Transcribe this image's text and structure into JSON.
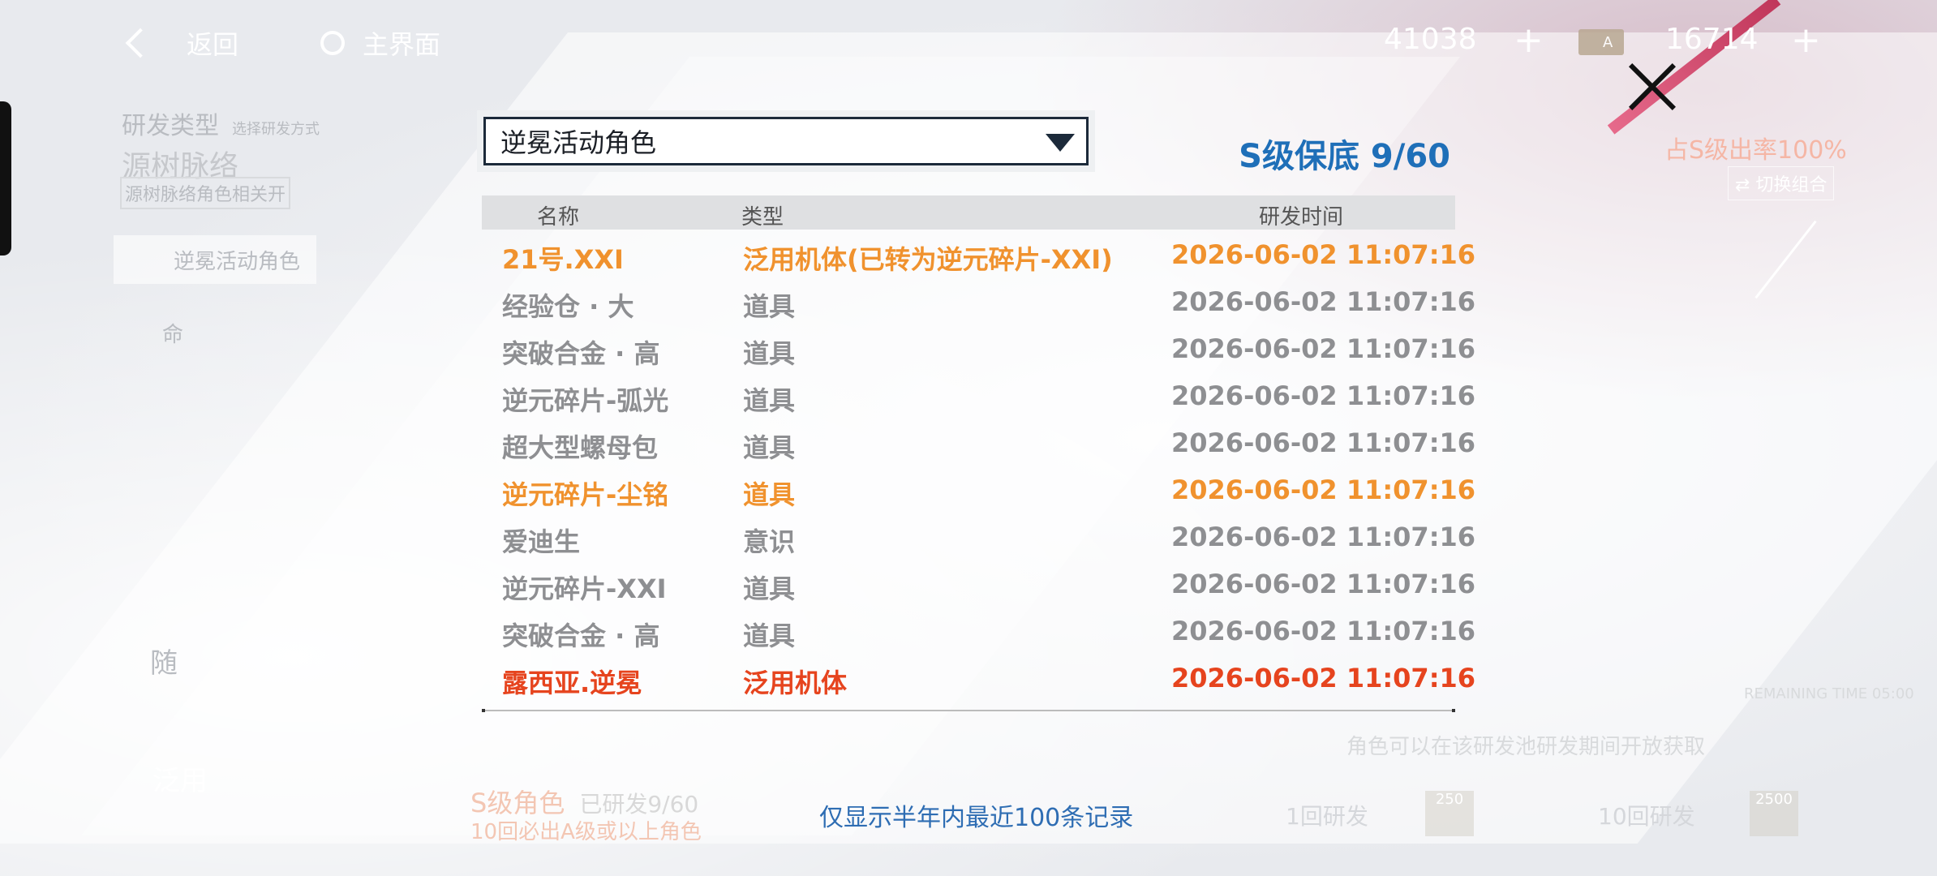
{
  "topbar": {
    "back_label": "返回",
    "home_label": "主界面",
    "currency1": "41038",
    "currency2": "16714",
    "plus": "+",
    "ticket_label": "A"
  },
  "background": {
    "type_label": "研发类型",
    "type_hint": "选择研发方式",
    "pool_title": "源树脉络",
    "pool_sub": "源树脉络角色相关开",
    "selected_pool": "逆冕活动角色",
    "other_pool": "命",
    "random_label": "随",
    "general_label": "泛用",
    "s_rank": "S级角色",
    "s_progress": "已研发9/60",
    "ten_pull_note": "10回必出A级或以上角色",
    "rate_label": "占S级出率100%",
    "switch_label": "切换组合",
    "single_label": "1回研发",
    "ten_label": "10回研发",
    "single_cost": "250",
    "ten_cost": "2500",
    "right_note": "角色可以在该研发池研发期间开放获取",
    "time_label": "REMAINING TIME 05:00"
  },
  "dialog": {
    "dropdown_value": "逆冕活动角色",
    "pity_label": "S级保底 9/60",
    "columns": {
      "name": "名称",
      "type": "类型",
      "time": "研发时间"
    },
    "rows": [
      {
        "name": "21号.XXI",
        "type": "泛用机体(已转为逆元碎片-XXI)",
        "time": "2026-06-02 11:07:16",
        "rarity": "gold"
      },
      {
        "name": "经验仓 · 大",
        "type": "道具",
        "time": "2026-06-02 11:07:16",
        "rarity": "normal"
      },
      {
        "name": "突破合金 · 高",
        "type": "道具",
        "time": "2026-06-02 11:07:16",
        "rarity": "normal"
      },
      {
        "name": "逆元碎片-弧光",
        "type": "道具",
        "time": "2026-06-02 11:07:16",
        "rarity": "normal"
      },
      {
        "name": "超大型螺母包",
        "type": "道具",
        "time": "2026-06-02 11:07:16",
        "rarity": "normal"
      },
      {
        "name": "逆元碎片-尘铭",
        "type": "道具",
        "time": "2026-06-02 11:07:16",
        "rarity": "gold"
      },
      {
        "name": "爱迪生",
        "type": "意识",
        "time": "2026-06-02 11:07:16",
        "rarity": "normal"
      },
      {
        "name": "逆元碎片-XXI",
        "type": "道具",
        "time": "2026-06-02 11:07:16",
        "rarity": "normal"
      },
      {
        "name": "突破合金 · 高",
        "type": "道具",
        "time": "2026-06-02 11:07:16",
        "rarity": "normal"
      },
      {
        "name": "露西亚.逆冕",
        "type": "泛用机体",
        "time": "2026-06-02 11:07:16",
        "rarity": "red"
      }
    ],
    "footer_note": "仅显示半年内最近100条记录"
  },
  "colors": {
    "gold": "#f0922e",
    "red": "#e6441e",
    "normal": "#8e8f92",
    "accent": "#1f6fb8"
  }
}
